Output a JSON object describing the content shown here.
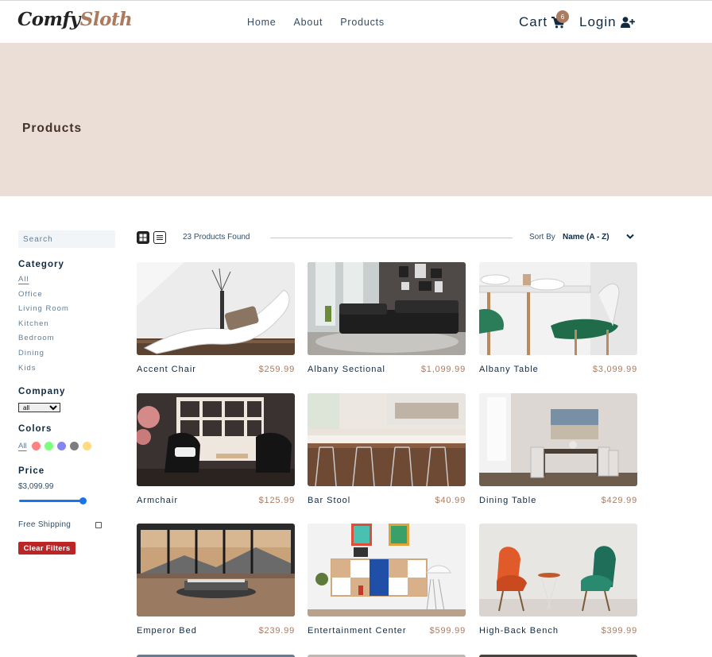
{
  "navbar": {
    "logo_part1": "Comfy",
    "logo_part2": "Sloth",
    "links": [
      "Home",
      "About",
      "Products"
    ],
    "cart_label": "Cart",
    "cart_count": "6",
    "login_label": "Login"
  },
  "hero": {
    "title": "Products"
  },
  "filters": {
    "search_placeholder": "Search",
    "category_heading": "Category",
    "categories": [
      "All",
      "Office",
      "Living Room",
      "Kitchen",
      "Bedroom",
      "Dining",
      "Kids"
    ],
    "active_category": "All",
    "company_heading": "Company",
    "company_selected": "all",
    "colors_heading": "Colors",
    "colors_all_label": "All",
    "color_swatches": [
      "#ff6b6b",
      "#66ff66",
      "#6f6ff0",
      "#666666",
      "#ffd36b"
    ],
    "price_heading": "Price",
    "price_value": "$3,099.99",
    "price_level": 1.0,
    "shipping_label": "Free Shipping",
    "shipping_checked": false,
    "clear_button": "Clear Filters"
  },
  "sort": {
    "products_found": "23 Products Found",
    "label": "Sort By",
    "selected": "Name (A - Z)"
  },
  "products": [
    {
      "name": "Accent Chair",
      "price": "$259.99"
    },
    {
      "name": "Albany Sectional",
      "price": "$1,099.99"
    },
    {
      "name": "Albany Table",
      "price": "$3,099.99"
    },
    {
      "name": "Armchair",
      "price": "$125.99"
    },
    {
      "name": "Bar Stool",
      "price": "$40.99"
    },
    {
      "name": "Dining Table",
      "price": "$429.99"
    },
    {
      "name": "Emperor Bed",
      "price": "$239.99"
    },
    {
      "name": "Entertainment Center",
      "price": "$599.99"
    },
    {
      "name": "High-Back Bench",
      "price": "$399.99"
    }
  ],
  "colors": {
    "accent": "#ab7a5f",
    "hero_bg": "#eaded7",
    "danger": "#bb2525",
    "text": "#102a42"
  }
}
